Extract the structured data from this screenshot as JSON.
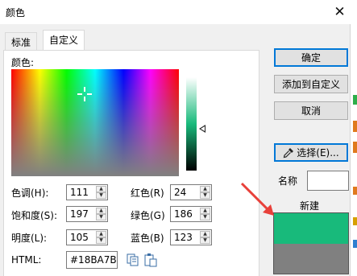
{
  "window": {
    "title": "颜色",
    "close_glyph": "✕"
  },
  "tabs": [
    {
      "label": "标准",
      "active": false
    },
    {
      "label": "自定义",
      "active": true
    }
  ],
  "custom": {
    "colors_label": "颜色:",
    "hue": {
      "label": "色调(H):",
      "value": "111"
    },
    "sat": {
      "label": "饱和度(S):",
      "value": "197"
    },
    "lum": {
      "label": "明度(L):",
      "value": "105"
    },
    "red": {
      "label": "红色(R)",
      "value": "24"
    },
    "green": {
      "label": "绿色(G)",
      "value": "186"
    },
    "blue": {
      "label": "蓝色(B)",
      "value": "123"
    },
    "html_label": "HTML:",
    "html_value": "#18BA7B"
  },
  "buttons": {
    "ok": "确定",
    "add_custom": "添加到自定义",
    "cancel": "取消",
    "pick": "选择(E)..."
  },
  "name_label": "名称",
  "new_label": "新建",
  "colors": {
    "new": "#18BA7B",
    "current": "#808080",
    "accent": "#0078D7",
    "annotation": "#E8403A"
  },
  "icons": {
    "copy": "copy-icon",
    "paste": "paste-icon",
    "eyedropper": "eyedropper-icon",
    "spin_up": "▲",
    "spin_down": "▼"
  }
}
